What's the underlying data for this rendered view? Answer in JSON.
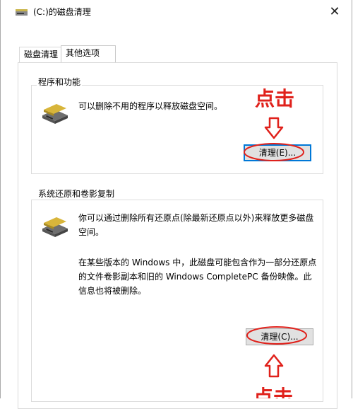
{
  "window": {
    "title": "(C:)的磁盘清理",
    "close_glyph": "✕"
  },
  "tabs": [
    {
      "label": "磁盘清理",
      "active": false
    },
    {
      "label": "其他选项",
      "active": true
    }
  ],
  "programs": {
    "label": "程序和功能",
    "description": "可以删除不用的程序以释放磁盘空间。",
    "button": "清理(E)...",
    "icon": "drive-icon"
  },
  "restore": {
    "label": "系统还原和卷影复制",
    "description1": "你可以通过删除所有还原点(除最新还原点以外)来释放更多磁盘空间。",
    "description2": "在某些版本的 Windows 中，此磁盘可能包含作为一部分还原点的文件卷影副本和旧的 Windows CompletePC 备份映像。此信息也将被删除。",
    "button": "清理(C)...",
    "icon": "drive-icon"
  },
  "annotations": {
    "callout_top": "点击",
    "callout_bottom": "点击",
    "color": "#e0211b"
  }
}
